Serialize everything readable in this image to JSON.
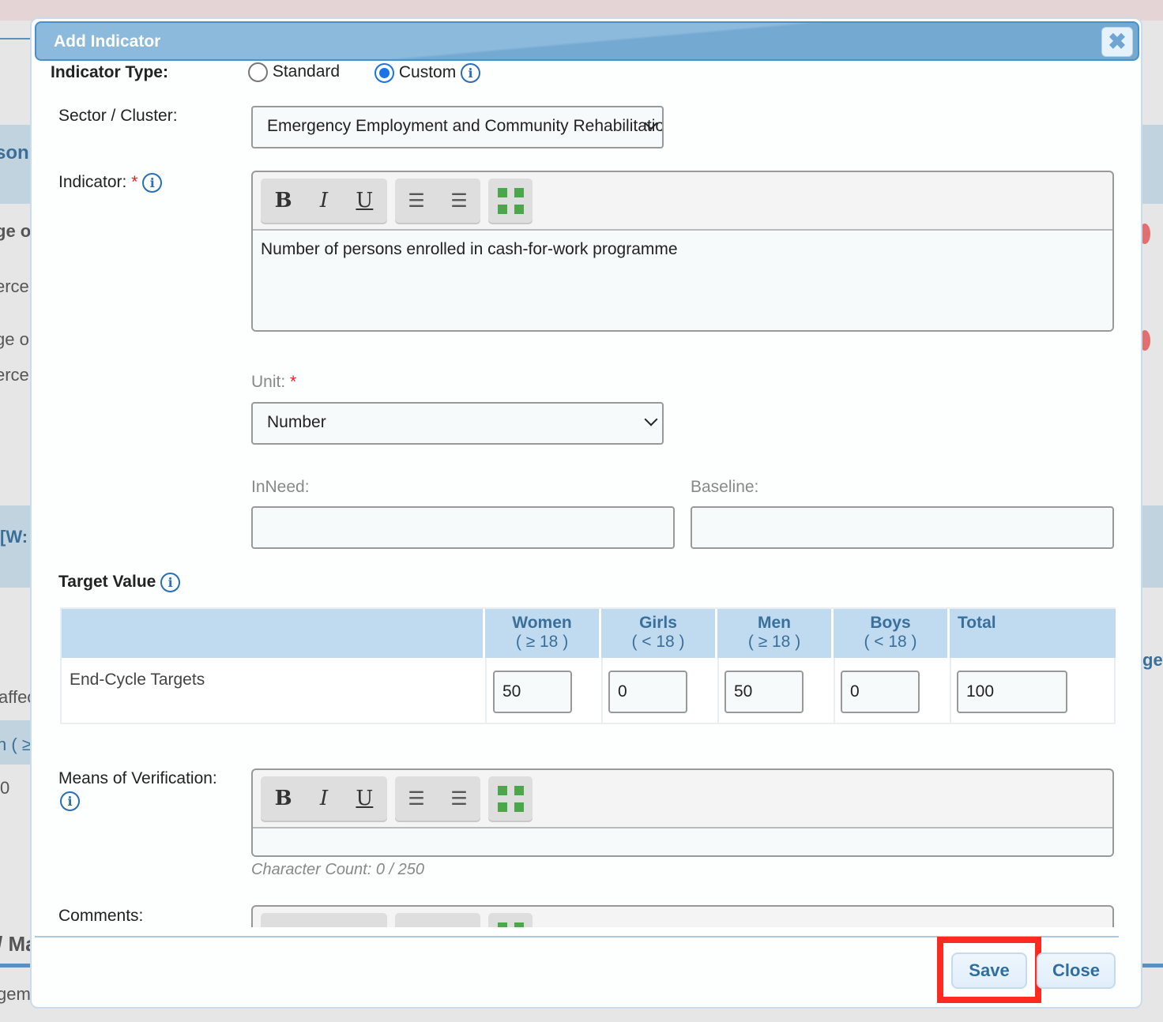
{
  "background": {
    "left_fragments": [
      "son",
      "ge o",
      "erce",
      "ge o",
      "erce",
      "[W:",
      "affec",
      "n ( ≥",
      "0",
      "/ Ma",
      "gem"
    ],
    "right_fragments": [
      "get"
    ]
  },
  "dialog": {
    "title": "Add Indicator",
    "close_icon": "close-x-icon",
    "indicator_type": {
      "label": "Indicator Type:",
      "options": [
        "Standard",
        "Custom"
      ],
      "selected": "Custom"
    },
    "sector": {
      "label": "Sector / Cluster:",
      "value": "Emergency Employment and Community Rehabilitation"
    },
    "indicator": {
      "label": "Indicator:",
      "required": "*",
      "value": "Number of persons enrolled in cash-for-work programme"
    },
    "toolbar": {
      "bold": "B",
      "italic": "I",
      "underline": "U"
    },
    "unit": {
      "label": "Unit:",
      "required": "*",
      "value": "Number"
    },
    "inneed": {
      "label": "InNeed:",
      "value": ""
    },
    "baseline": {
      "label": "Baseline:",
      "value": ""
    },
    "target": {
      "label": "Target Value",
      "columns": [
        {
          "name": "Women",
          "age": "( ≥ 18 )"
        },
        {
          "name": "Girls",
          "age": "( < 18 )"
        },
        {
          "name": "Men",
          "age": "( ≥ 18 )"
        },
        {
          "name": "Boys",
          "age": "( < 18 )"
        },
        {
          "name": "Total",
          "age": ""
        }
      ],
      "row_label": "End-Cycle Targets",
      "values": [
        "50",
        "0",
        "50",
        "0",
        "100"
      ]
    },
    "mov": {
      "label": "Means of Verification:",
      "value": "",
      "char_count": "Character Count: 0 / 250"
    },
    "comments": {
      "label": "Comments:"
    },
    "buttons": {
      "save": "Save",
      "close": "Close"
    },
    "colors": {
      "header": "#7aaed5",
      "accent": "#1a73e8",
      "highlight": "#ff2a1f"
    }
  }
}
